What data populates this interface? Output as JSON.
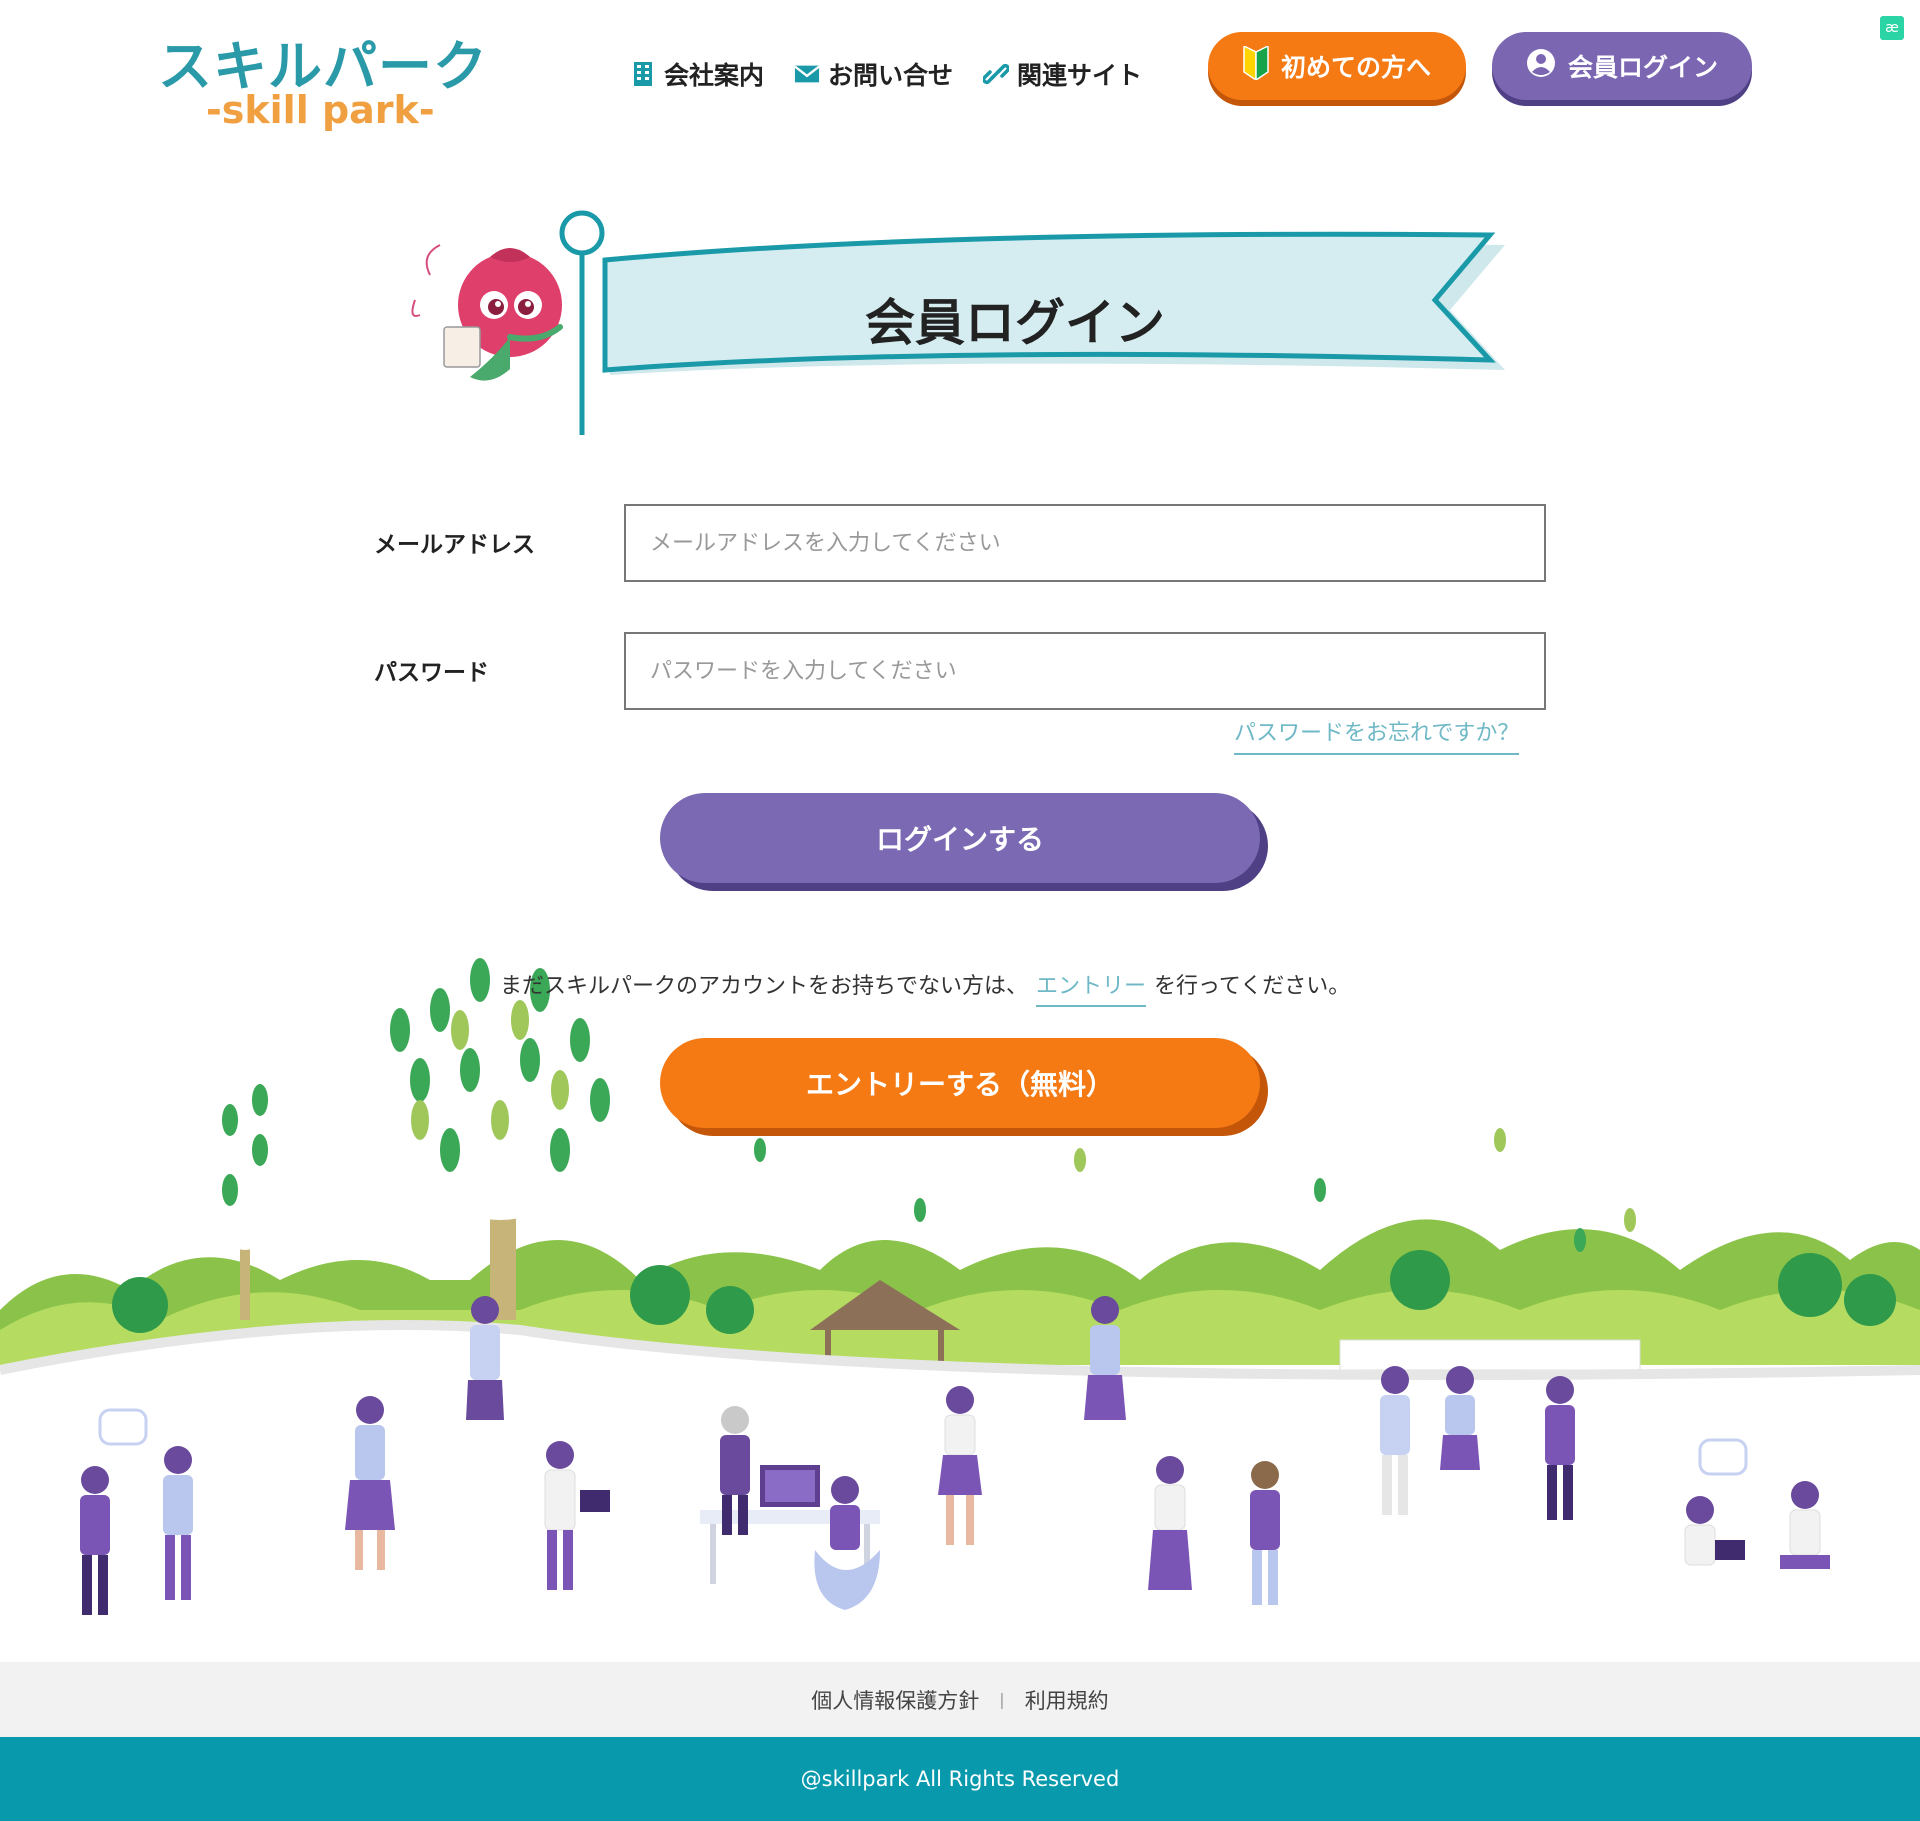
{
  "header": {
    "logo_jp": "スキルパーク",
    "logo_en": "-skill park-",
    "nav": [
      {
        "label": "会社案内",
        "icon": "building-icon"
      },
      {
        "label": "お問い合せ",
        "icon": "envelope-icon"
      },
      {
        "label": "関連サイト",
        "icon": "link-icon"
      }
    ],
    "first_time_label": "初めての方へ",
    "member_login_label": "会員ログイン"
  },
  "page": {
    "title": "会員ログイン"
  },
  "form": {
    "email_label": "メールアドレス",
    "email_placeholder": "メールアドレスを入力してください",
    "email_value": "",
    "password_label": "パスワード",
    "password_placeholder": "パスワードを入力してください",
    "password_value": "",
    "forgot_label": "パスワードをお忘れですか？",
    "submit_label": "ログインする"
  },
  "entry": {
    "note_before": "まだスキルパークのアカウントをお持ちでない方は、",
    "note_link": "エントリー",
    "note_after": "を行ってください。",
    "button_label": "エントリーする（無料）"
  },
  "footer": {
    "privacy_label": "個人情報保護方針",
    "separator": "|",
    "terms_label": "利用規約",
    "copyright": "@skillpark All Rights Reserved"
  },
  "colors": {
    "accent_teal": "#0899ad",
    "accent_purple": "#7b66b2",
    "accent_orange": "#f57a14",
    "link": "#6fb8c6"
  }
}
